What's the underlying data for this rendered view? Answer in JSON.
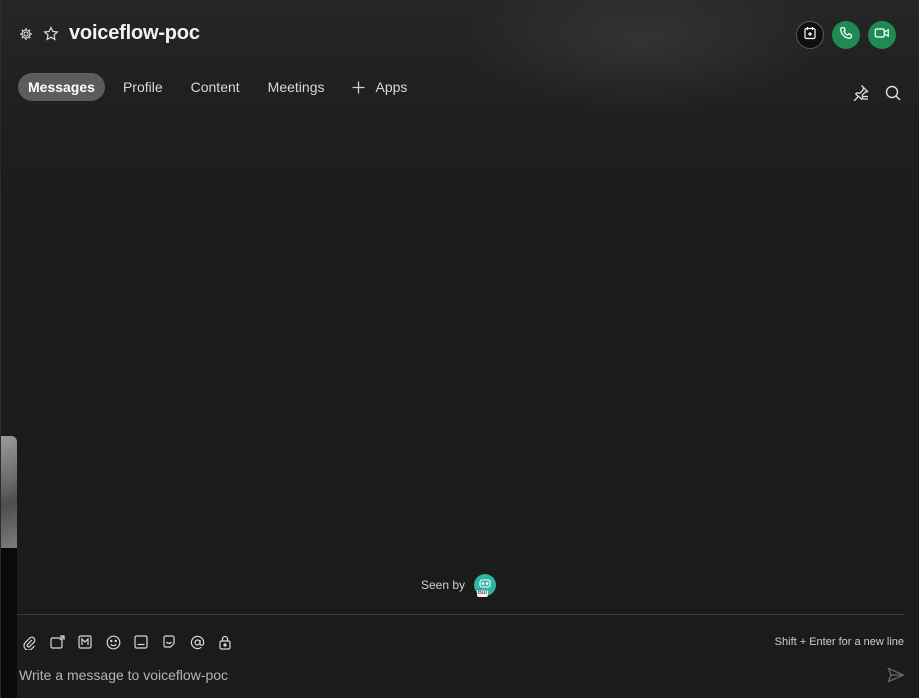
{
  "header": {
    "title": "voiceflow-poc",
    "settings_icon": "gear-icon",
    "favorite_icon": "star-icon",
    "call_buttons": [
      {
        "name": "add-to-calendar-button",
        "icon": "calendar-plus-icon"
      },
      {
        "name": "audio-call-button",
        "icon": "phone-icon",
        "color": "#1f8a52"
      },
      {
        "name": "video-call-button",
        "icon": "video-icon",
        "color": "#1f8a52"
      }
    ]
  },
  "tabs": {
    "messages": "Messages",
    "profile": "Profile",
    "content": "Content",
    "meetings": "Meetings",
    "apps": "Apps",
    "active": "Messages"
  },
  "tools": {
    "pin_icon": "pin-icon",
    "search_icon": "search-icon"
  },
  "seen": {
    "label": "Seen by",
    "avatar_badge": "Bot",
    "avatar_color": "#2fb5a4"
  },
  "composer": {
    "hint": "Shift + Enter for a new line",
    "placeholder": "Write a message to voiceflow-poc",
    "value": "",
    "tools": [
      "attach-icon",
      "share-screen-icon",
      "markdown-icon",
      "emoji-icon",
      "gif-icon",
      "sticker-icon",
      "mention-icon",
      "secure-icon"
    ]
  }
}
